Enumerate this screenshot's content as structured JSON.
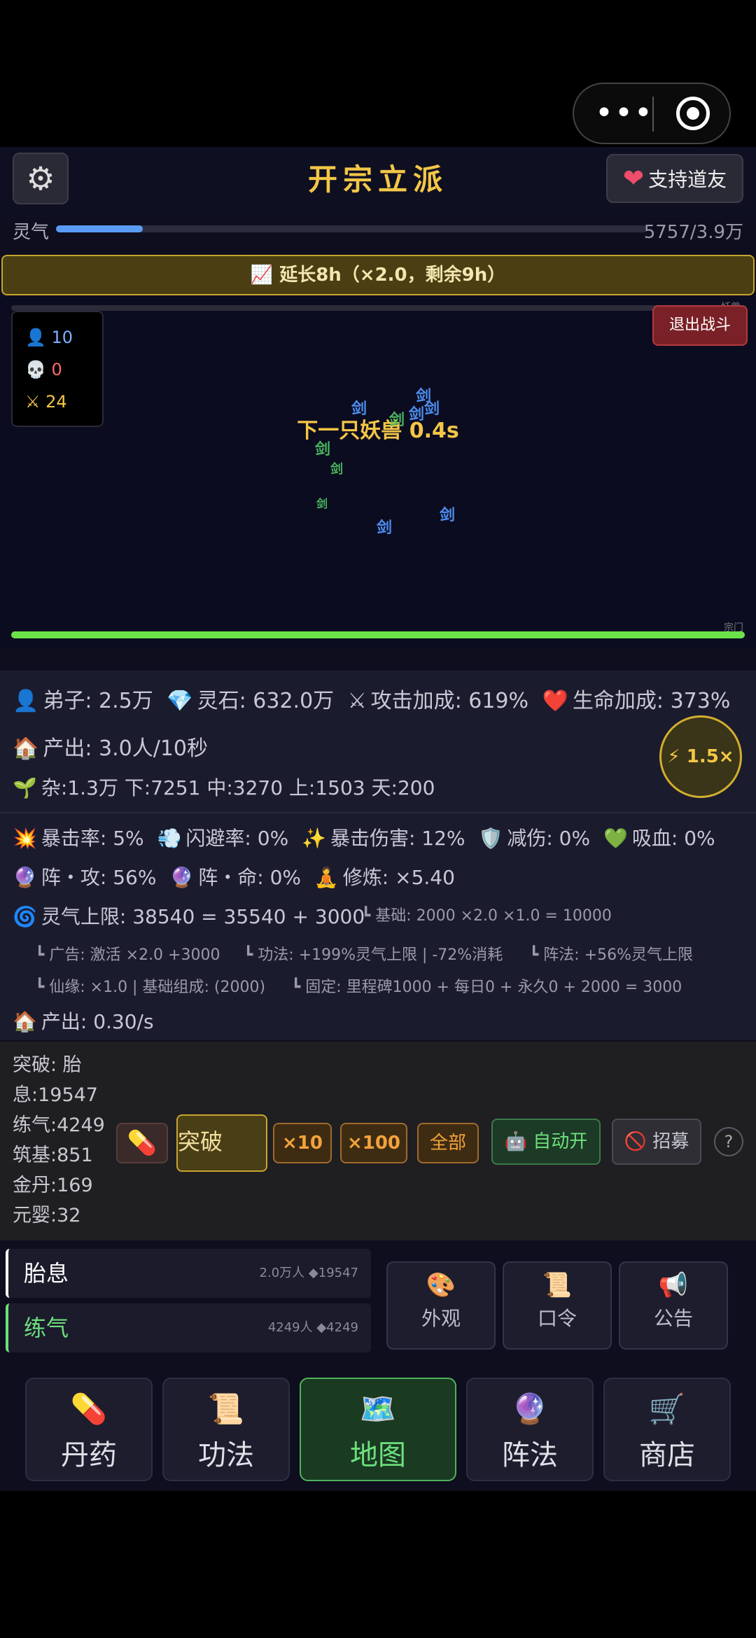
{
  "system": {
    "more_glyph": "•••"
  },
  "header": {
    "title": "开宗立派",
    "settings_icon": "⚙",
    "support_icon": "❤",
    "support_label": "支持道友"
  },
  "qi": {
    "label": "灵气",
    "value": "5757/3.9万",
    "progress": 0.147
  },
  "banner": {
    "icon": "📈",
    "text": "延长8h（×2.0，剩余9h）"
  },
  "battle": {
    "enemy_label": "妖兽",
    "sect_label": "宗门",
    "stats": [
      {
        "icon": "👤",
        "value": "10",
        "color": "#7fb0ff"
      },
      {
        "icon": "💀",
        "value": "0",
        "color": "#ff6b6b"
      },
      {
        "icon": "⚔",
        "value": "24",
        "color": "#f3c646"
      }
    ],
    "exit_label": "退出战斗",
    "next_enemy": "下一只妖兽 0.4s",
    "sword_glyph": "剑"
  },
  "stats": {
    "line1": [
      {
        "icon": "👤",
        "text": "弟子: 2.5万"
      },
      {
        "icon": "💎",
        "text": "灵石: 632.0万"
      },
      {
        "icon": "⚔",
        "text": "攻击加成: 619%"
      },
      {
        "icon": "❤️",
        "text": "生命加成: 373%"
      }
    ],
    "production": {
      "icon": "🏠",
      "text": "产出: 3.0人/10秒"
    },
    "speed": {
      "icon": "⚡",
      "text": "1.5×"
    },
    "grades": {
      "icon": "🌱",
      "text": "杂:1.3万 下:7251 中:3270 上:1503 天:200"
    },
    "combat": [
      {
        "icon": "💥",
        "text": "暴击率: 5%"
      },
      {
        "icon": "💨",
        "text": "闪避率: 0%"
      },
      {
        "icon": "✨",
        "text": "暴击伤害: 12%"
      },
      {
        "icon": "🛡️",
        "text": "减伤: 0%"
      },
      {
        "icon": "💚",
        "text": "吸血: 0%"
      }
    ],
    "formation": [
      {
        "icon": "🔮",
        "text": "阵・攻: 56%"
      },
      {
        "icon": "🔮",
        "text": "阵・命: 0%"
      },
      {
        "icon": "🧘",
        "text": "修炼: ×5.40"
      }
    ],
    "qi_cap": {
      "icon": "🌀",
      "text": "灵气上限: 38540 = 35540 + 3000"
    },
    "base": "┗ 基础: 2000 ×2.0 ×1.0 = 10000",
    "ad": "┗ 广告: 激活 ×2.0 +3000",
    "technique": "┗ 功法: +199%灵气上限 | -72%消耗",
    "array": "┗ 阵法: +56%灵气上限",
    "fate": "┗ 仙缘: ×1.0 | 基础组成: (2000)",
    "fixed": "┗ 固定: 里程碑1000 + 每日0 + 永久0 + 2000 = 3000",
    "output": {
      "icon": "🏠",
      "text": "产出: 0.30/s"
    }
  },
  "breakthrough": {
    "list": [
      "突破: 胎",
      "息:19547",
      "练气:4249",
      "筑基:851",
      "金丹:169",
      "元婴:32"
    ],
    "pill_icon": "💊",
    "break_label": "突破",
    "x10": "×10",
    "x100": "×100",
    "all": "全部",
    "auto": "🤖 自动开",
    "recruit": "🚫 招募",
    "help": "?"
  },
  "realms": [
    {
      "name": "胎息",
      "meta": "2.0万人 ◆19547",
      "color": "#ffffff"
    },
    {
      "name": "练气",
      "meta": "4249人 ◆4249",
      "color": "#6de07c"
    }
  ],
  "grid": [
    {
      "icon": "🎨",
      "label": "外观"
    },
    {
      "icon": "📜",
      "label": "口令"
    },
    {
      "icon": "📢",
      "label": "公告"
    }
  ],
  "nav": [
    {
      "icon": "💊",
      "label": "丹药"
    },
    {
      "icon": "📜",
      "label": "功法"
    },
    {
      "icon": "🗺️",
      "label": "地图"
    },
    {
      "icon": "🔮",
      "label": "阵法"
    },
    {
      "icon": "🛒",
      "label": "商店"
    }
  ]
}
